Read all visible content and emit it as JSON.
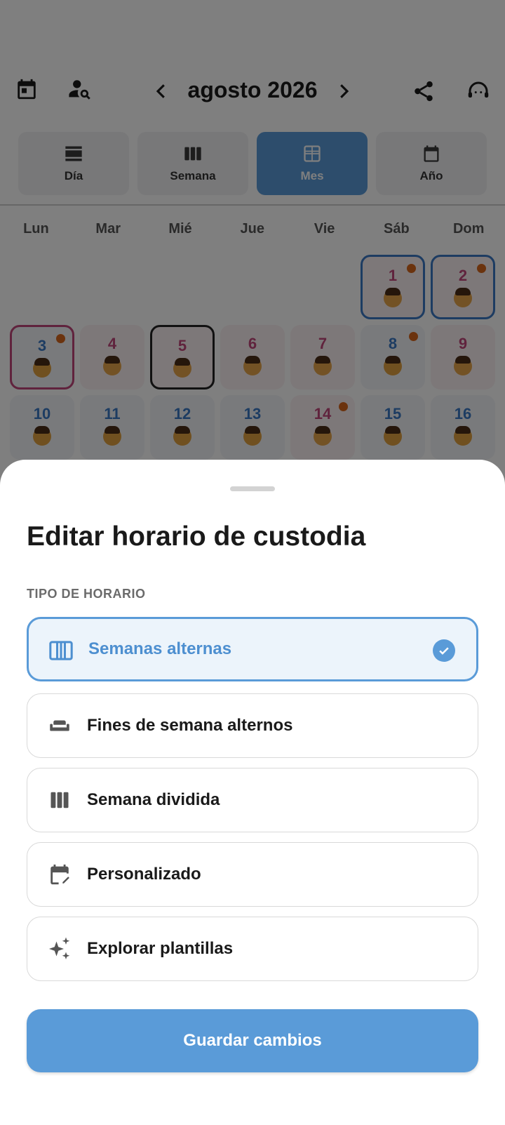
{
  "calendar": {
    "month_title": "agosto 2026",
    "view_tabs": [
      {
        "label": "Día"
      },
      {
        "label": "Semana"
      },
      {
        "label": "Mes"
      },
      {
        "label": "Año"
      }
    ],
    "active_view": "Mes",
    "weekdays": [
      "Lun",
      "Mar",
      "Mié",
      "Jue",
      "Vie",
      "Sáb",
      "Dom"
    ],
    "days": [
      {
        "n": "1",
        "parent": "mom",
        "dot": true,
        "sel": "blue"
      },
      {
        "n": "2",
        "parent": "mom",
        "dot": true,
        "sel": "blue"
      },
      {
        "n": "3",
        "parent": "dad",
        "dot": true,
        "sel": "pink"
      },
      {
        "n": "4",
        "parent": "mom",
        "dot": false,
        "sel": ""
      },
      {
        "n": "5",
        "parent": "mom",
        "dot": false,
        "sel": "dark"
      },
      {
        "n": "6",
        "parent": "mom",
        "dot": false,
        "sel": ""
      },
      {
        "n": "7",
        "parent": "mom",
        "dot": false,
        "sel": ""
      },
      {
        "n": "8",
        "parent": "dad",
        "dot": true,
        "sel": ""
      },
      {
        "n": "9",
        "parent": "mom",
        "dot": false,
        "sel": ""
      },
      {
        "n": "10",
        "parent": "dad",
        "dot": false,
        "sel": ""
      },
      {
        "n": "11",
        "parent": "dad",
        "dot": false,
        "sel": ""
      },
      {
        "n": "12",
        "parent": "dad",
        "dot": false,
        "sel": ""
      },
      {
        "n": "13",
        "parent": "dad",
        "dot": false,
        "sel": ""
      },
      {
        "n": "14",
        "parent": "mom",
        "dot": true,
        "sel": ""
      },
      {
        "n": "15",
        "parent": "dad",
        "dot": false,
        "sel": ""
      },
      {
        "n": "16",
        "parent": "dad",
        "dot": false,
        "sel": ""
      }
    ]
  },
  "sheet": {
    "title": "Editar horario de custodia",
    "section_label": "TIPO DE HORARIO",
    "options": [
      {
        "label": "Semanas alternas",
        "icon": "view-week-icon",
        "selected": true
      },
      {
        "label": "Fines de semana alternos",
        "icon": "weekend-sofa-icon",
        "selected": false
      },
      {
        "label": "Semana dividida",
        "icon": "view-column-icon",
        "selected": false
      },
      {
        "label": "Personalizado",
        "icon": "edit-calendar-icon",
        "selected": false
      },
      {
        "label": "Explorar plantillas",
        "icon": "sparkle-icon",
        "selected": false
      }
    ],
    "save_label": "Guardar cambios"
  },
  "colors": {
    "accent": "#5a9bd8",
    "dad": "#3a79c4",
    "mom": "#c0467a",
    "event_dot": "#d7661c"
  }
}
